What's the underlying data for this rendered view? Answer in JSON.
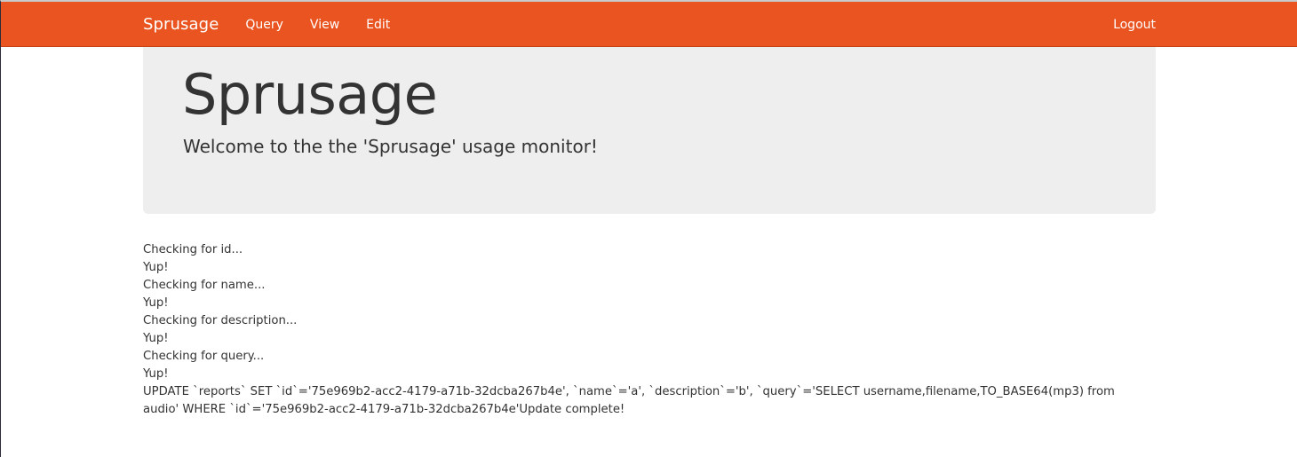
{
  "navbar": {
    "brand": "Sprusage",
    "links": [
      {
        "label": "Query"
      },
      {
        "label": "View"
      },
      {
        "label": "Edit"
      }
    ],
    "logout_label": "Logout",
    "background_color": "#e95420"
  },
  "jumbotron": {
    "title": "Sprusage",
    "lead": "Welcome to the the 'Sprusage' usage monitor!"
  },
  "output": {
    "lines": [
      "Checking for id...",
      "Yup!",
      "Checking for name...",
      "Yup!",
      "Checking for description...",
      "Yup!",
      "Checking for query...",
      "Yup!"
    ],
    "update_statement": "UPDATE `reports` SET `id`='75e969b2-acc2-4179-a71b-32dcba267b4e', `name`='a', `description`='b', `query`='SELECT username,filename,TO_BASE64(mp3) from audio' WHERE `id`='75e969b2-acc2-4179-a71b-32dcba267b4e'Update complete!"
  }
}
